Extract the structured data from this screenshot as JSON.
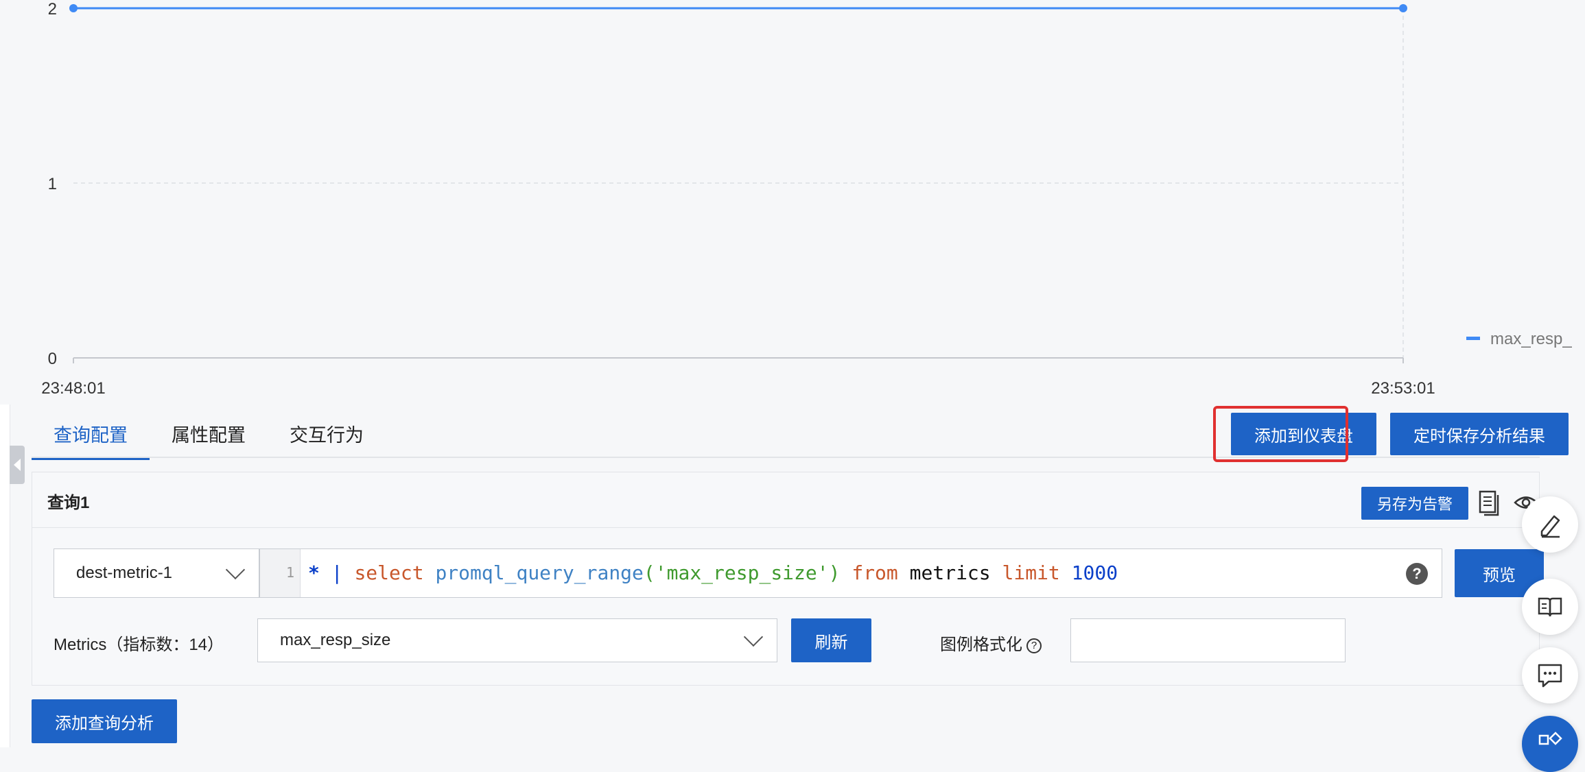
{
  "chart_data": {
    "type": "line",
    "x": [
      "23:48:01",
      "23:53:01"
    ],
    "series": [
      {
        "name": "max_resp_",
        "values": [
          2,
          2
        ]
      }
    ],
    "yticks": [
      0,
      1,
      2
    ],
    "ylim": [
      0,
      2
    ],
    "xtick_labels": [
      "23:48:01",
      "23:53:01"
    ],
    "legend": "right",
    "grid": true,
    "color": "#3f8af5"
  },
  "tabs": [
    {
      "label": "查询配置",
      "active": true
    },
    {
      "label": "属性配置",
      "active": false
    },
    {
      "label": "交互行为",
      "active": false
    }
  ],
  "actions": {
    "add_dashboard": "添加到仪表盘",
    "schedule_save": "定时保存分析结果"
  },
  "query": {
    "title": "查询1",
    "save_alert": "另存为告警",
    "logstore": "dest-metric-1",
    "line_number": "1",
    "code_tokens": {
      "t1": "*",
      "t2": " | ",
      "t3": "select",
      "t4": " ",
      "t5": "promql_query_range",
      "t6": "(",
      "t7": "'max_resp_size'",
      "t8": ") ",
      "t9": "from",
      "t10": " metrics ",
      "t11": "limit",
      "t12": " ",
      "t13": "1000"
    },
    "help": "?",
    "preview": "预览",
    "metrics_label": "Metrics（指标数：14）",
    "metric_value": "max_resp_size",
    "refresh": "刷新",
    "legend_format_label": "图例格式化",
    "legend_format_value": ""
  },
  "add_query": "添加查询分析",
  "icons": {
    "copy": "copy-icon",
    "eye": "eye-icon",
    "edit": "edit-icon",
    "book": "book-icon",
    "chat": "chat-icon",
    "apps": "apps-icon"
  },
  "colors": {
    "primary": "#1e63c6",
    "highlight": "#e03030",
    "series": "#3f8af5"
  }
}
